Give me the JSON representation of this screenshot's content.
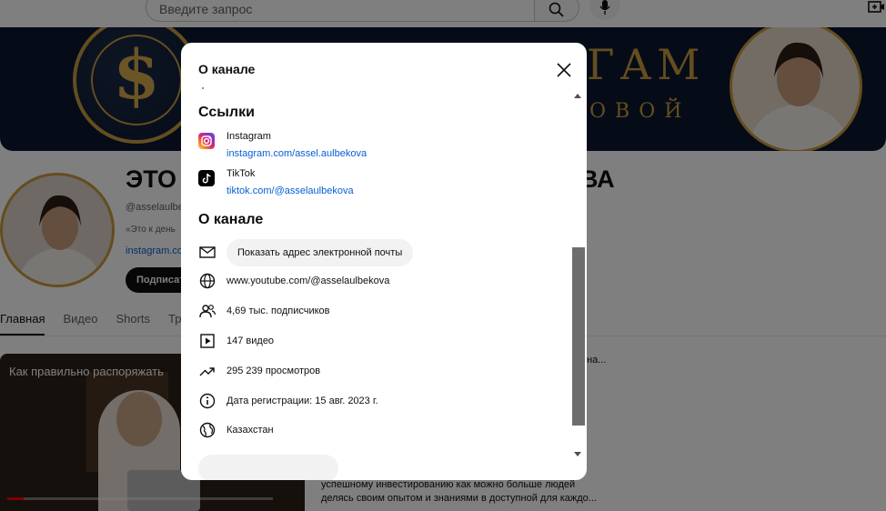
{
  "header": {
    "search_placeholder": "Введите запрос"
  },
  "banner": {
    "title_fragment": "ГАМ",
    "subtitle_fragment": "ОВОЙ"
  },
  "channel": {
    "title_start": "ЭТО",
    "title_end": "ВА",
    "handle_fragment": "@asselaulbe",
    "desc_fragment": "«Это к день",
    "link_fragment": "instagram.co",
    "subscribe_label": "Подписат"
  },
  "tabs": [
    "Главная",
    "Видео",
    "Shorts",
    "Тра"
  ],
  "video": {
    "title": "Как правильно распоряжать",
    "progress_fraction": 0.06
  },
  "side_text": {
    "line1": "я на...",
    "line2": "успешному инвестированию как можно больше людей",
    "line3": "делясь своим опытом и знаниями в доступной для каждо..."
  },
  "dialog": {
    "title": "О канале",
    "links_heading": "Ссылки",
    "links": [
      {
        "name": "Instagram",
        "url": "instagram.com/assel.aulbekova",
        "icon": "instagram-icon"
      },
      {
        "name": "TikTok",
        "url": "tiktok.com/@asselaulbekova",
        "icon": "tiktok-icon"
      }
    ],
    "about_heading": "О канале",
    "email_button": "Показать адрес электронной почты",
    "channel_url": "www.youtube.com/@asselaulbekova",
    "subscribers": "4,69 тыс. подписчиков",
    "videos": "147 видео",
    "views": "295 239 просмотров",
    "registered": "Дата регистрации: 15 авг. 2023 г.",
    "country": "Казахстан"
  },
  "colors": {
    "link": "#065fd4",
    "banner_bg": "#0b1830",
    "gold": "#c99a3e"
  }
}
